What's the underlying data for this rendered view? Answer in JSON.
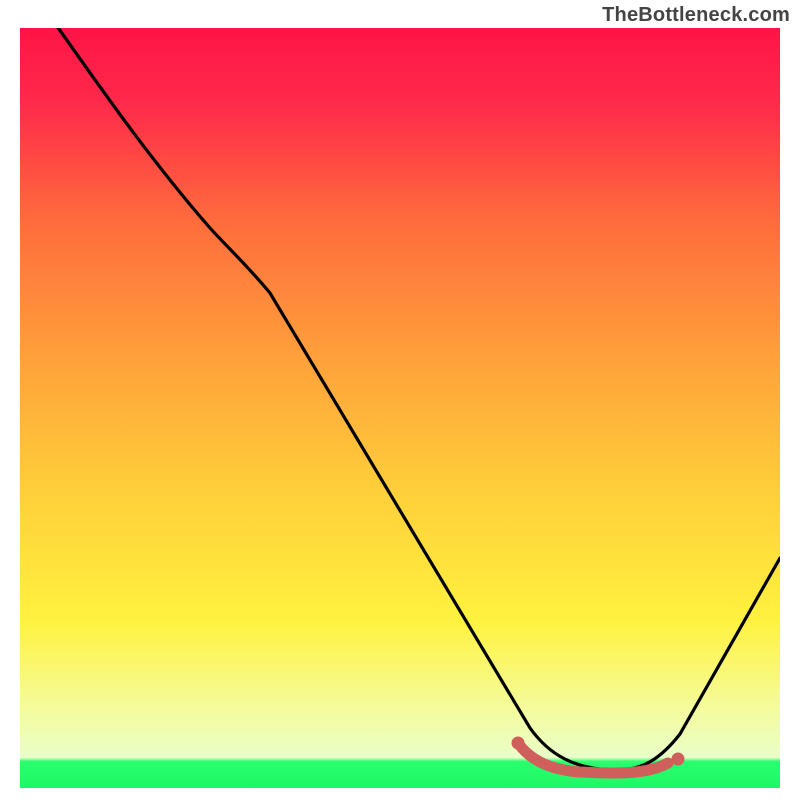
{
  "chart_data": {
    "type": "line",
    "title": "",
    "xlabel": "",
    "ylabel": "",
    "xlim": [
      0,
      100
    ],
    "ylim": [
      0,
      100
    ],
    "watermark": "TheBottleneck.com",
    "background_gradient": {
      "top": "#ff1a4c",
      "mid_upper": "#ff6a3a",
      "mid": "#ffd23a",
      "mid_lower": "#f7f97a",
      "bottom_band": "#2aff6e"
    },
    "series": [
      {
        "name": "bottleneck-curve",
        "color": "#000000",
        "x": [
          0,
          5,
          12,
          22,
          30,
          40,
          50,
          60,
          68,
          72,
          75,
          78,
          82,
          86,
          90,
          95,
          100
        ],
        "y": [
          110,
          103,
          94,
          82,
          73,
          57,
          42,
          26,
          12,
          5,
          2,
          0.5,
          0.5,
          2,
          9,
          21,
          33
        ]
      },
      {
        "name": "highlight-points",
        "color": "#d6605c",
        "type": "scatter",
        "x": [
          68,
          70,
          72,
          74,
          76,
          78,
          80,
          82,
          84
        ],
        "y": [
          3,
          2.2,
          1.6,
          1.2,
          1.0,
          1.0,
          1.2,
          1.6,
          2.2
        ]
      }
    ]
  },
  "watermark_text": "TheBottleneck.com"
}
